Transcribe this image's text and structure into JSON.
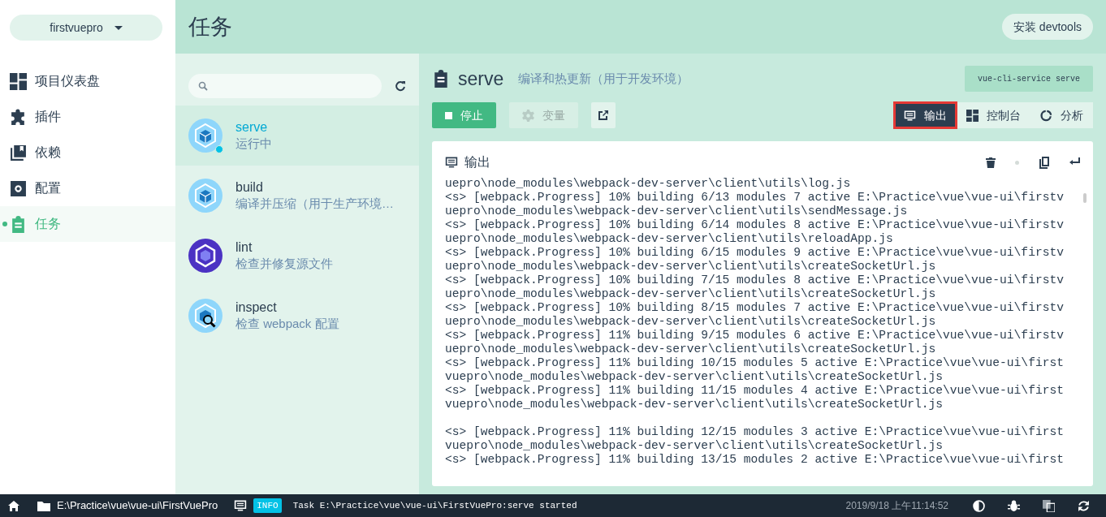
{
  "project_selector": {
    "label": "firstvuepro"
  },
  "nav": [
    {
      "label": "项目仪表盘",
      "kind": "dashboard",
      "selected": false
    },
    {
      "label": "插件",
      "kind": "puzzle",
      "selected": false
    },
    {
      "label": "依赖",
      "kind": "library",
      "selected": false
    },
    {
      "label": "配置",
      "kind": "gear",
      "selected": false
    },
    {
      "label": "任务",
      "kind": "clipboard",
      "selected": true
    }
  ],
  "header": {
    "title": "任务",
    "action": "安装 devtools"
  },
  "tasks": [
    {
      "name": "serve",
      "description": "运行中",
      "kind": "webpack",
      "running": true,
      "selected": true
    },
    {
      "name": "build",
      "description": "编译并压缩（用于生产环境…",
      "kind": "webpack",
      "running": false,
      "selected": false
    },
    {
      "name": "lint",
      "description": "检查并修复源文件",
      "kind": "eslint",
      "running": false,
      "selected": false
    },
    {
      "name": "inspect",
      "description": "检查 webpack 配置",
      "kind": "inspect",
      "running": false,
      "selected": false
    }
  ],
  "task_detail": {
    "name": "serve",
    "description": "编译和热更新（用于开发环境）",
    "command": "vue-cli-service serve",
    "actions": [
      {
        "label": "停止",
        "kind": "stop",
        "disabled": false
      },
      {
        "label": "变量",
        "kind": "params",
        "disabled": true
      },
      {
        "kind": "open",
        "disabled": false
      }
    ],
    "views": [
      {
        "label": "输出",
        "kind": "output",
        "selected": true
      },
      {
        "label": "控制台",
        "kind": "dashboard",
        "selected": false
      },
      {
        "label": "分析",
        "kind": "donut",
        "selected": false
      }
    ]
  },
  "output": {
    "title": "输出",
    "lines": [
      {
        "text": "uepro\\node_modules\\webpack-dev-server\\client\\utils\\log.js"
      },
      {
        "text": "<s> [webpack.Progress] 10% building 6/13 modules 7 active E:\\Practice\\vue\\vue-ui\\firstv"
      },
      {
        "text": "uepro\\node_modules\\webpack-dev-server\\client\\utils\\sendMessage.js"
      },
      {
        "text": "<s> [webpack.Progress] 10% building 6/14 modules 8 active E:\\Practice\\vue\\vue-ui\\firstv"
      },
      {
        "text": "uepro\\node_modules\\webpack-dev-server\\client\\utils\\reloadApp.js"
      },
      {
        "text": "<s> [webpack.Progress] 10% building 6/15 modules 9 active E:\\Practice\\vue\\vue-ui\\firstv"
      },
      {
        "text": "uepro\\node_modules\\webpack-dev-server\\client\\utils\\createSocketUrl.js"
      },
      {
        "text": "<s> [webpack.Progress] 10% building 7/15 modules 8 active E:\\Practice\\vue\\vue-ui\\firstv"
      },
      {
        "text": "uepro\\node_modules\\webpack-dev-server\\client\\utils\\createSocketUrl.js"
      },
      {
        "text": "<s> [webpack.Progress] 10% building 8/15 modules 7 active E:\\Practice\\vue\\vue-ui\\firstv"
      },
      {
        "text": "uepro\\node_modules\\webpack-dev-server\\client\\utils\\createSocketUrl.js"
      },
      {
        "text": "<s> [webpack.Progress] 11% building 9/15 modules 6 active E:\\Practice\\vue\\vue-ui\\firstv"
      },
      {
        "text": "uepro\\node_modules\\webpack-dev-server\\client\\utils\\createSocketUrl.js"
      },
      {
        "text": "<s> [webpack.Progress] 11% building 10/15 modules 5 active E:\\Practice\\vue\\vue-ui\\first"
      },
      {
        "text": "vuepro\\node_modules\\webpack-dev-server\\client\\utils\\createSocketUrl.js"
      },
      {
        "text": "<s> [webpack.Progress] 11% building 11/15 modules 4 active E:\\Practice\\vue\\vue-ui\\first"
      },
      {
        "text": "vuepro\\node_modules\\webpack-dev-server\\client\\utils\\createSocketUrl.js"
      },
      {
        "text": "<s> [webpack.Progress] 11% building 12/15 modules 3 active E:\\Practice\\vue\\vue-ui\\first",
        "gap_before": true
      },
      {
        "text": "vuepro\\node_modules\\webpack-dev-server\\client\\utils\\createSocketUrl.js"
      },
      {
        "text": "<s> [webpack.Progress] 11% building 13/15 modules 2 active E:\\Practice\\vue\\vue-ui\\first"
      }
    ]
  },
  "status_bar": {
    "path": "E:\\Practice\\vue\\vue-ui\\FirstVuePro",
    "log_level": "INFO",
    "message": "Task E:\\Practice\\vue\\vue-ui\\FirstVuePro:serve started",
    "time": "2019/9/18 上午11:14:52"
  }
}
